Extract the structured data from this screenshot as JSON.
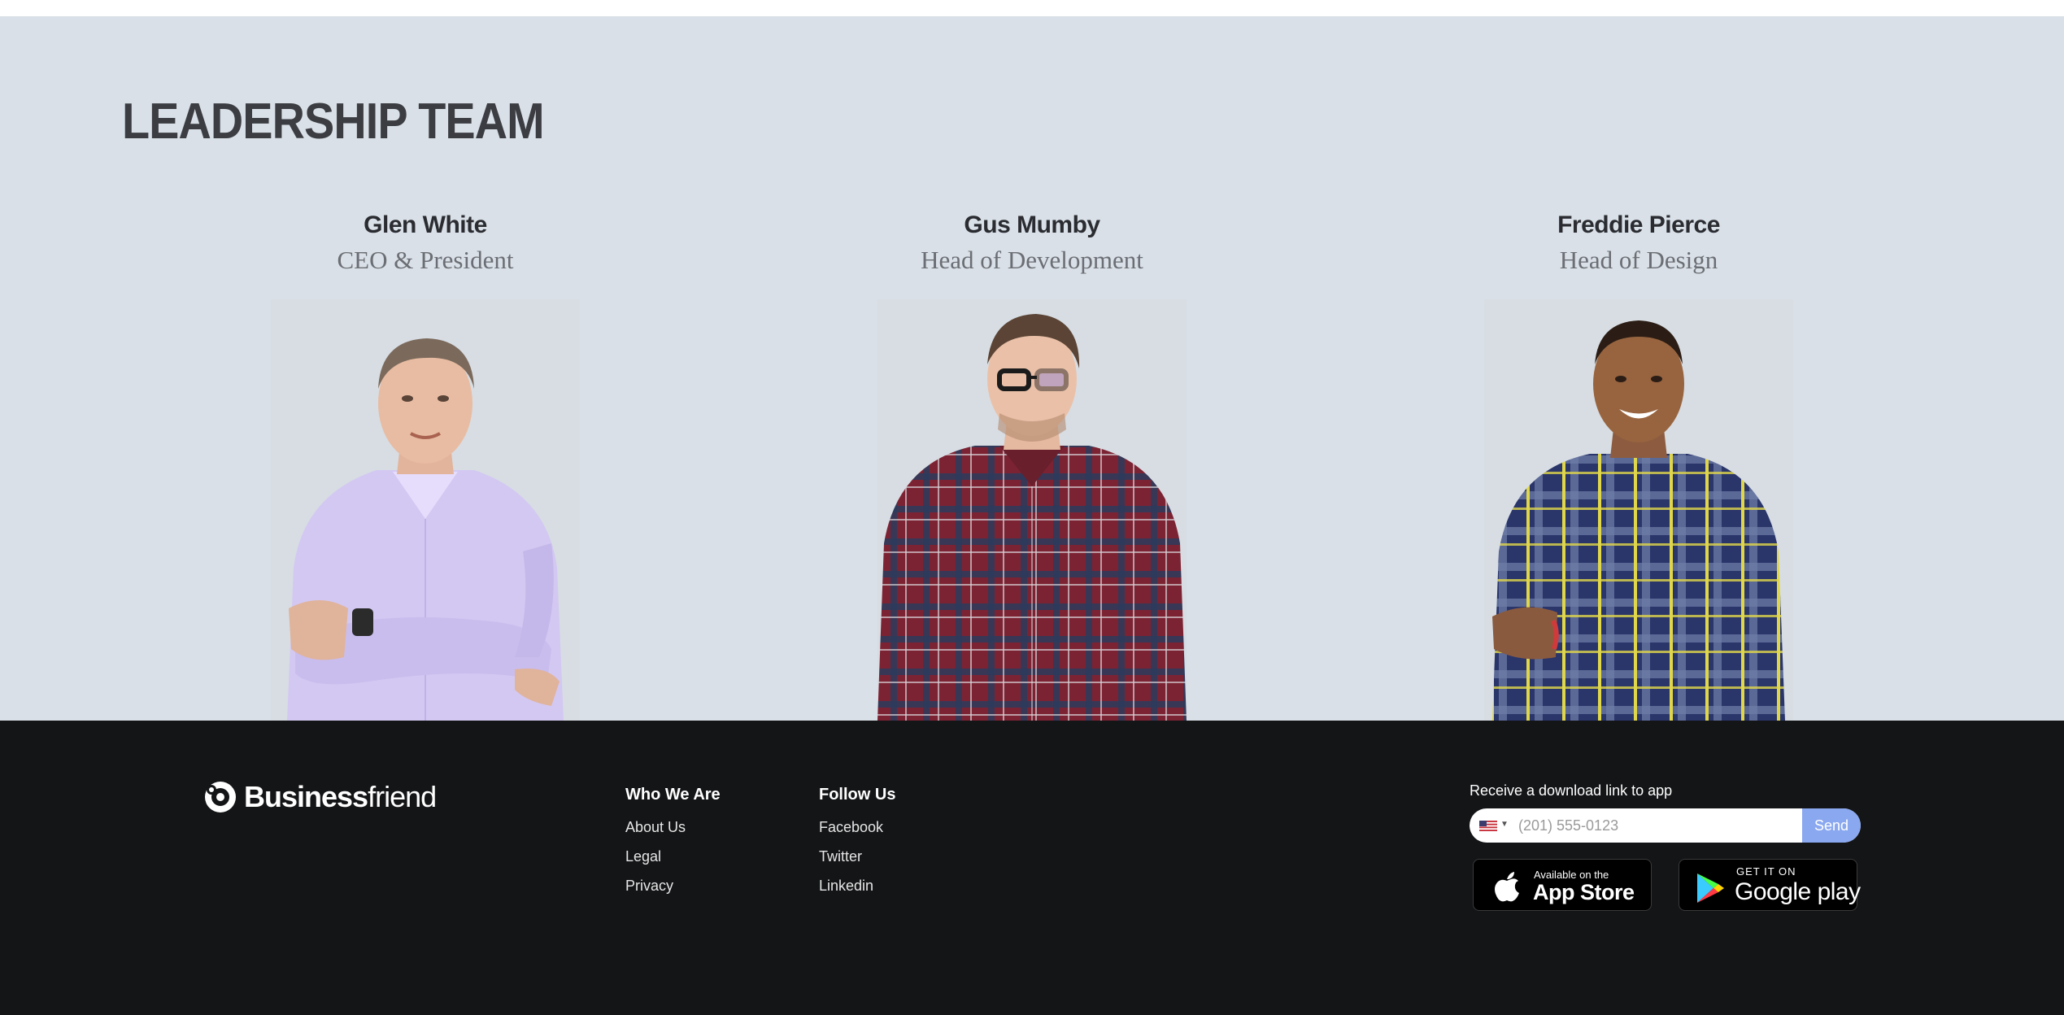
{
  "leadership": {
    "title": "LEADERSHIP TEAM",
    "members": [
      {
        "name": "Glen White",
        "role": "CEO & President"
      },
      {
        "name": "Gus Mumby",
        "role": "Head of Development"
      },
      {
        "name": "Freddie Pierce",
        "role": "Head of Design"
      }
    ]
  },
  "footer": {
    "logo": {
      "bold": "Business",
      "light": "friend"
    },
    "columns": [
      {
        "title": "Who We Are",
        "links": [
          "About Us",
          "Legal",
          "Privacy"
        ]
      },
      {
        "title": "Follow Us",
        "links": [
          "Facebook",
          "Twitter",
          "Linkedin"
        ]
      }
    ],
    "download": {
      "label": "Receive a download link to app",
      "placeholder": "(201) 555-0123",
      "send_label": "Send",
      "flag_icon": "us-flag-icon"
    },
    "badges": {
      "apple": {
        "small": "Available on the",
        "big": "App Store",
        "icon": "apple-icon"
      },
      "google": {
        "small": "GET IT ON",
        "big": "Google play",
        "icon": "google-play-icon"
      }
    }
  },
  "colors": {
    "section_bg": "#d9e0e7",
    "footer_bg": "#141517",
    "send_button": "#8aa8f0",
    "heading": "#3b3d42"
  }
}
